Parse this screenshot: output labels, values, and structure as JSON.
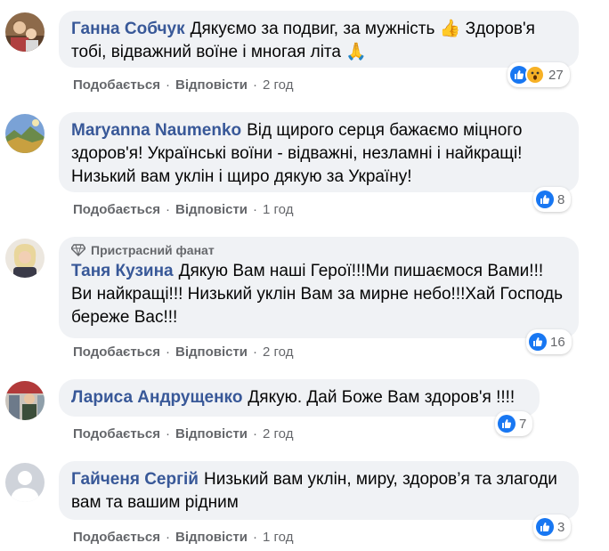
{
  "comments": [
    {
      "author": "Ганна Собчук",
      "text": "Дякуємо за подвиг, за мужність 👍 Здоров'я тобі, відважний воїне і многая літа 🙏",
      "badge": "",
      "like_label": "Подобається",
      "reply_label": "Відповісти",
      "time": "2 год",
      "reaction_count": "27",
      "reactions": [
        "like-icon",
        "wow-icon"
      ]
    },
    {
      "author": "Maryanna Naumenko",
      "text": "Від щирого серця бажаємо міцного здоров'я! Українські воїни - відважні, незламні і найкращі! Низький вам уклін і щиро дякую за Україну!",
      "badge": "",
      "like_label": "Подобається",
      "reply_label": "Відповісти",
      "time": "1 год",
      "reaction_count": "8",
      "reactions": [
        "like-icon"
      ]
    },
    {
      "author": "Таня Кузина",
      "text": "Дякую Вам наші Герої!!!Ми пишаємося Вами!!! Ви найкращі!!! Низький уклін Вам за мирне небо!!!Хай Господь береже Вас!!!",
      "badge": "Пристрасний фанат",
      "like_label": "Подобається",
      "reply_label": "Відповісти",
      "time": "2 год",
      "reaction_count": "16",
      "reactions": [
        "like-icon"
      ]
    },
    {
      "author": "Лариса Андрущенко",
      "text": "Дякую. Дай Боже Вам здоров'я !!!!",
      "badge": "",
      "like_label": "Подобається",
      "reply_label": "Відповісти",
      "time": "2 год",
      "reaction_count": "7",
      "reactions": [
        "like-icon"
      ]
    },
    {
      "author": "Гайченя Сергій",
      "text": "Низький вам уклін, миру, здоров’я та злагоди вам та вашим рідним",
      "badge": "",
      "like_label": "Подобається",
      "reply_label": "Відповісти",
      "time": "1 год",
      "reaction_count": "3",
      "reactions": [
        "like-icon"
      ]
    }
  ],
  "colors": {
    "author": "#385898",
    "bubble": "#f0f2f5",
    "meta": "#65676b",
    "like": "#1877f2"
  }
}
